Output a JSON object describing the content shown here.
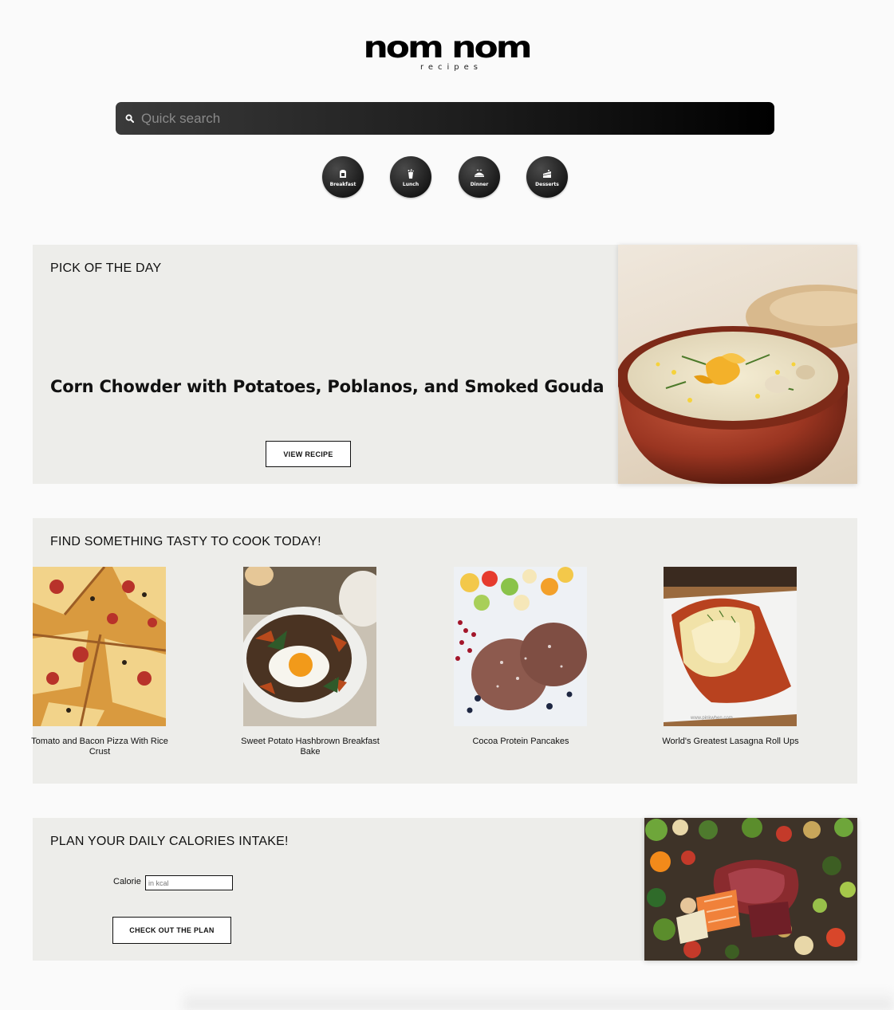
{
  "logo": {
    "main": "nom nom",
    "sub": "recipes"
  },
  "search": {
    "placeholder": "Quick search",
    "icon": "search-icon"
  },
  "categories": [
    {
      "label": "Breakfast",
      "icon": "toast-icon"
    },
    {
      "label": "Lunch",
      "icon": "drink-icon"
    },
    {
      "label": "Dinner",
      "icon": "dish-icon"
    },
    {
      "label": "Desserts",
      "icon": "cake-icon"
    }
  ],
  "pick": {
    "title": "PICK OF THE DAY",
    "recipe": "Corn Chowder with Potatoes, Poblanos, and Smoked Gouda",
    "button": "VIEW RECIPE"
  },
  "tasty": {
    "title": "FIND SOMETHING TASTY TO COOK TODAY!",
    "recipes": [
      {
        "name": "Tomato and Bacon Pizza With Rice Crust"
      },
      {
        "name": "Sweet Potato Hashbrown Breakfast Bake"
      },
      {
        "name": "Cocoa Protein Pancakes"
      },
      {
        "name": "World's Greatest Lasagna Roll Ups"
      }
    ]
  },
  "plan": {
    "title": "PLAN YOUR DAILY CALORIES INTAKE!",
    "calorie_label": "Calorie",
    "calorie_placeholder": "in kcal",
    "calorie_value": "",
    "button": "CHECK OUT THE PLAN"
  },
  "watermark": "www.pinkwhen.com",
  "colors": {
    "panel": "#ededea",
    "page": "#fafafa",
    "dark": "#111111"
  }
}
